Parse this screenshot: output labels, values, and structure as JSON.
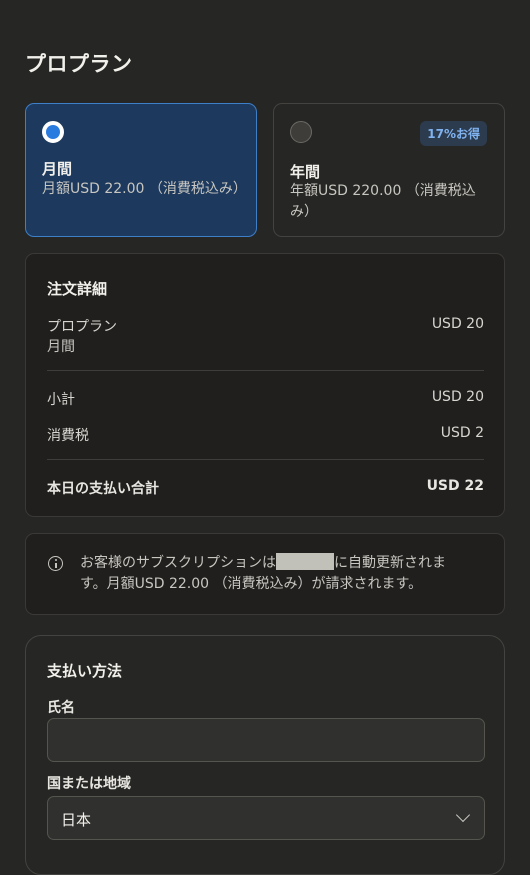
{
  "page": {
    "title": "プロプラン"
  },
  "plans": [
    {
      "name": "月間",
      "price": "月額USD 22.00 （消費税込み）",
      "selected": true
    },
    {
      "name": "年間",
      "price": "年額USD 220.00 （消費税込み）",
      "selected": false,
      "badge": "17%お得"
    }
  ],
  "order": {
    "title": "注文詳細",
    "item_name": "プロプラン",
    "item_period": "月間",
    "item_price": "USD 20",
    "subtotal_label": "小計",
    "subtotal_value": "USD 20",
    "tax_label": "消費税",
    "tax_value": "USD 2",
    "total_label": "本日の支払い合計",
    "total_value": "USD 22"
  },
  "info": {
    "text_before": "お客様のサブスクリプションは",
    "text_after": "に自動更新されます。月額USD 22.00 （消費税込み）が請求されます。"
  },
  "payment": {
    "title": "支払い方法",
    "name_label": "氏名",
    "name_value": "",
    "country_label": "国または地域",
    "country_value": "日本"
  },
  "colors": {
    "background": "#262624",
    "selected_plan_bg": "#1d3a5e",
    "selected_plan_border": "#3d7fc9",
    "badge_text": "#7fb2ee"
  }
}
